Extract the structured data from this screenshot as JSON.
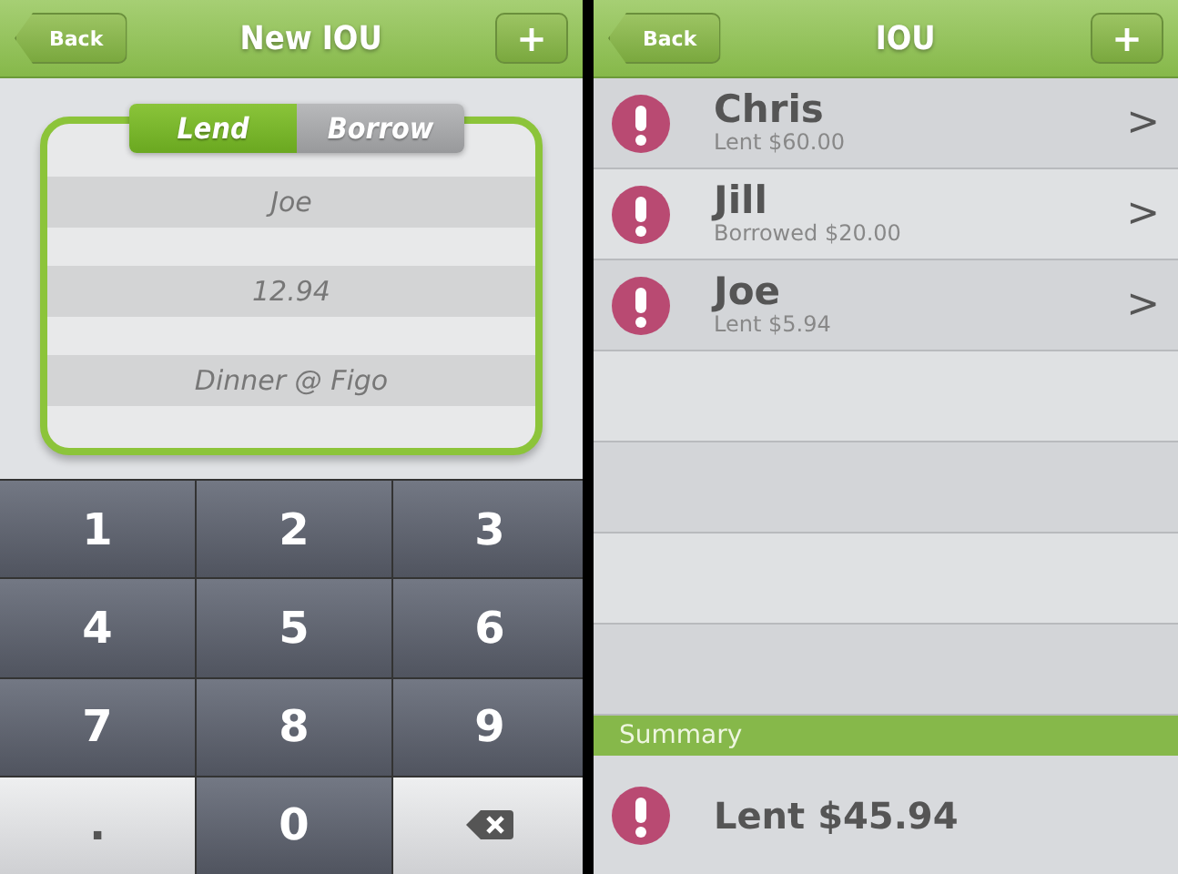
{
  "new_iou": {
    "header": {
      "back": "Back",
      "title": "New IOU",
      "add": "+"
    },
    "tabs": [
      {
        "label": "Lend",
        "selected": true
      },
      {
        "label": "Borrow",
        "selected": false
      }
    ],
    "fields": [
      {
        "value": "Joe"
      },
      {
        "value": "12.94"
      },
      {
        "value": "Dinner @ Figo"
      }
    ],
    "keypad": [
      {
        "kind": "digit",
        "label": "1"
      },
      {
        "kind": "digit",
        "label": "2"
      },
      {
        "kind": "digit",
        "label": "3"
      },
      {
        "kind": "digit",
        "label": "4"
      },
      {
        "kind": "digit",
        "label": "5"
      },
      {
        "kind": "digit",
        "label": "6"
      },
      {
        "kind": "digit",
        "label": "7"
      },
      {
        "kind": "digit",
        "label": "8"
      },
      {
        "kind": "digit",
        "label": "9"
      },
      {
        "kind": "point",
        "label": "."
      },
      {
        "kind": "digit",
        "label": "0"
      },
      {
        "kind": "delete"
      }
    ]
  },
  "iou_list": {
    "header": {
      "back": "Back",
      "title": "IOU",
      "add": "+"
    },
    "rows": [
      {
        "name": "Chris",
        "detail": "Lent $60.00",
        "chevron": ">"
      },
      {
        "name": "Jill",
        "detail": "Borrowed $20.00",
        "chevron": ">"
      },
      {
        "name": "Joe",
        "detail": "Lent $5.94",
        "chevron": ">"
      }
    ],
    "summary": {
      "heading": "Summary",
      "text": "Lent $45.94"
    }
  }
}
